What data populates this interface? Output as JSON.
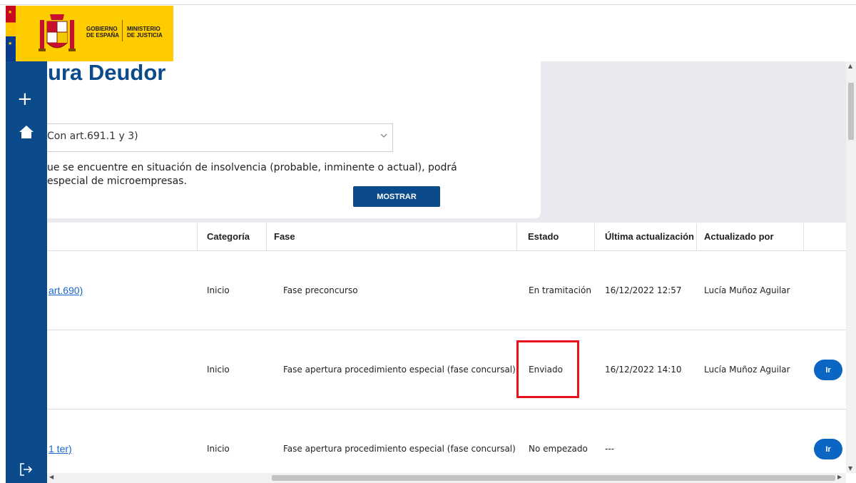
{
  "header": {
    "logo_left": [
      "GOBIERNO",
      "DE ESPAÑA"
    ],
    "logo_right": [
      "MINISTERIO",
      "DE JUSTICIA"
    ]
  },
  "page": {
    "title": "ura Deudor"
  },
  "filter": {
    "selected": "Con art.691.1 y 3)",
    "description_line1": "ue se encuentre en situación de insolvencia (probable, inminente o actual), podrá",
    "description_line2": "especial de microempresas.",
    "button_label": "MOSTRAR"
  },
  "table": {
    "headers": {
      "categoria": "Categoría",
      "fase": "Fase",
      "estado": "Estado",
      "ultima_actualizacion": "Última actualización",
      "actualizado_por": "Actualizado por"
    },
    "rows": [
      {
        "link": "art.690)",
        "categoria": "Inicio",
        "fase": "Fase preconcurso",
        "estado": "En tramitación",
        "fecha": "16/12/2022 12:57",
        "usuario": "Lucía Muñoz Aguilar",
        "action": ""
      },
      {
        "link": "",
        "categoria": "Inicio",
        "fase": "Fase apertura procedimiento especial (fase concursal)",
        "estado": "Enviado",
        "fecha": "16/12/2022 14:10",
        "usuario": "Lucía Muñoz Aguilar",
        "action": "Ir"
      },
      {
        "link": "1 ter)",
        "categoria": "Inicio",
        "fase": "Fase apertura procedimiento especial (fase concursal)",
        "estado": "No empezado",
        "fecha": "---",
        "usuario": "",
        "action": "Ir"
      }
    ]
  },
  "colors": {
    "brand_blue": "#0b4a8b",
    "button_blue": "#0a66c2",
    "link_blue": "#1a66c9",
    "logo_yellow": "#ffcc00",
    "highlight_red": "#e8101a",
    "band_gray": "#e9eaef"
  },
  "icons": {
    "sidebar_add": "plus-icon",
    "sidebar_home": "home-icon",
    "sidebar_logout": "logout-icon",
    "select_chevron": "chevron-down-icon"
  }
}
